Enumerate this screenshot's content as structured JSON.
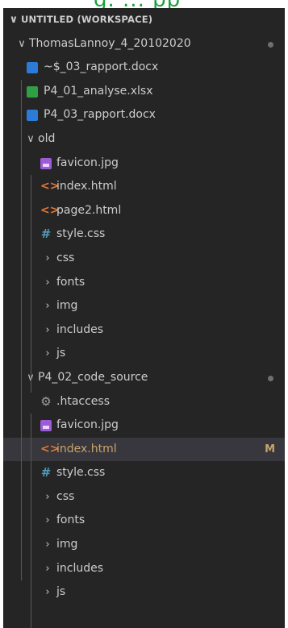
{
  "explorer": {
    "workspace_title": "UNTITLED (WORKSPACE)",
    "top_text": "g. ... pp"
  },
  "tree": {
    "root": {
      "label": "ThomasLannoy_4_20102020"
    },
    "root_files": [
      {
        "label": "~$_03_rapport.docx",
        "icon": "word-icon"
      },
      {
        "label": "P4_01_analyse.xlsx",
        "icon": "excel-icon"
      },
      {
        "label": "P4_03_rapport.docx",
        "icon": "word-icon"
      }
    ],
    "old": {
      "label": "old",
      "files": [
        {
          "label": "favicon.jpg",
          "icon": "image-icon"
        },
        {
          "label": "index.html",
          "icon": "html-icon"
        },
        {
          "label": "page2.html",
          "icon": "html-icon"
        },
        {
          "label": "style.css",
          "icon": "css-icon"
        }
      ],
      "folders": [
        "css",
        "fonts",
        "img",
        "includes",
        "js"
      ]
    },
    "code_source": {
      "label": "P4_02_code_source",
      "files": [
        {
          "label": ".htaccess",
          "icon": "gear-icon"
        },
        {
          "label": "favicon.jpg",
          "icon": "image-icon"
        },
        {
          "label": "index.html",
          "icon": "html-icon",
          "status": "M"
        },
        {
          "label": "style.css",
          "icon": "css-icon"
        }
      ],
      "folders": [
        "css",
        "fonts",
        "img",
        "includes",
        "js"
      ]
    }
  },
  "icons": {
    "chevron_down": "∨",
    "chevron_right": "›",
    "html_glyph": "<>",
    "css_glyph": "#",
    "gear_glyph": "⚙"
  },
  "colors": {
    "background": "#252526",
    "selected_row": "#37373d",
    "modified": "#c9a36b",
    "html": "#e37933",
    "css": "#519aba"
  }
}
